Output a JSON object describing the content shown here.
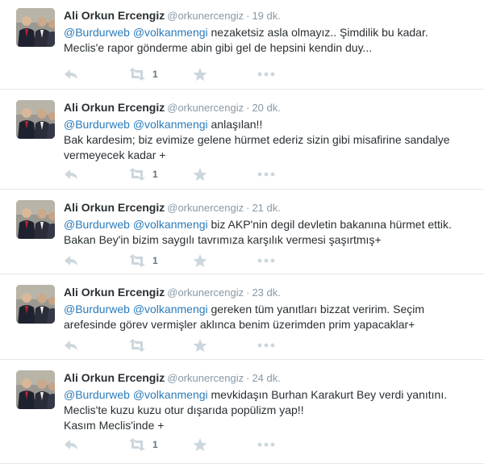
{
  "colors": {
    "mention": "#2b7bb9",
    "meta": "#8899a6",
    "action_icon": "#ccd6dd",
    "divider": "#e1e8ed"
  },
  "tweets": [
    {
      "fullname": "Ali Orkun Ercengiz",
      "username": "@orkunercengiz",
      "separator": "·",
      "time": "19 dk.",
      "lines": [
        {
          "m1": "@Burdurweb",
          "m2": "@volkanmengi",
          "rest": " nezaketsiz asla olmayız.. Şimdilik bu kadar."
        },
        {
          "plain": "Meclis'e rapor gönderme abin gibi gel de hepsini kendin duy..."
        }
      ],
      "retweet_count": "1",
      "icons": [
        "reply-icon",
        "retweet-icon",
        "favorite-icon",
        "more-icon"
      ]
    },
    {
      "fullname": "Ali Orkun Ercengiz",
      "username": "@orkunercengiz",
      "separator": "·",
      "time": "20 dk.",
      "lines": [
        {
          "m1": "@Burdurweb",
          "m2": "@volkanmengi",
          "rest": " anlaşılan!!"
        },
        {
          "plain": "Bak kardesim; biz evimize gelene hürmet ederiz sizin gibi misafirine sandalye"
        },
        {
          "plain": "vermeyecek kadar +"
        }
      ],
      "retweet_count": "1",
      "icons": [
        "reply-icon",
        "retweet-icon",
        "favorite-icon",
        "more-icon"
      ]
    },
    {
      "fullname": "Ali Orkun Ercengiz",
      "username": "@orkunercengiz",
      "separator": "·",
      "time": "21 dk.",
      "lines": [
        {
          "m1": "@Burdurweb",
          "m2": "@volkanmengi",
          "rest": " biz AKP'nin degil devletin bakanına hürmet ettik."
        },
        {
          "plain": "Bakan Bey'in bizim saygılı tavrımıza karşılık vermesi şaşırtmış+"
        }
      ],
      "retweet_count": "1",
      "icons": [
        "reply-icon",
        "retweet-icon",
        "favorite-icon",
        "more-icon"
      ]
    },
    {
      "fullname": "Ali Orkun Ercengiz",
      "username": "@orkunercengiz",
      "separator": "·",
      "time": "23 dk.",
      "lines": [
        {
          "m1": "@Burdurweb",
          "m2": "@volkanmengi",
          "rest": " gereken tüm yanıtları bizzat veririm. Seçim"
        },
        {
          "plain": "arefesinde görev vermişler aklınca benim üzerimden prim yapacaklar+"
        }
      ],
      "retweet_count": "",
      "icons": [
        "reply-icon",
        "retweet-icon",
        "favorite-icon",
        "more-icon"
      ]
    },
    {
      "fullname": "Ali Orkun Ercengiz",
      "username": "@orkunercengiz",
      "separator": "·",
      "time": "24 dk.",
      "lines": [
        {
          "m1": "@Burdurweb",
          "m2": "@volkanmengi",
          "rest": " mevkidaşın Burhan Karakurt Bey verdi yanıtını."
        },
        {
          "plain": "Meclis'te kuzu kuzu otur dışarıda popülizm yap!!"
        },
        {
          "plain": "Kasım Meclis'inde +"
        }
      ],
      "retweet_count": "1",
      "icons": [
        "reply-icon",
        "retweet-icon",
        "favorite-icon",
        "more-icon"
      ]
    }
  ]
}
